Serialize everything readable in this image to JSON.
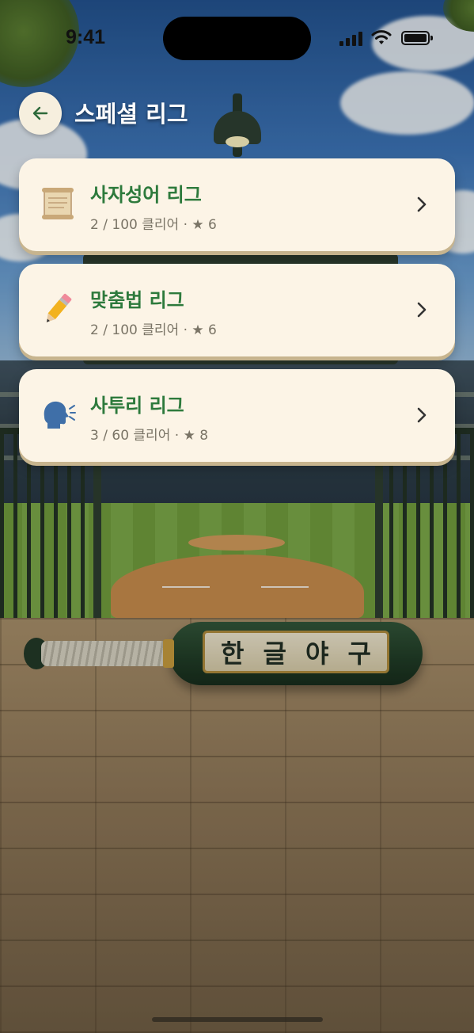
{
  "status_bar": {
    "time": "9:41"
  },
  "header": {
    "title": "스페셜 리그"
  },
  "leagues": [
    {
      "title": "사자성어 리그",
      "cleared": "2",
      "total": "100",
      "clear_label": "클리어",
      "separator": "·",
      "star": "★",
      "stars": "6",
      "icon": "scroll-icon"
    },
    {
      "title": "맞춤법 리그",
      "cleared": "2",
      "total": "100",
      "clear_label": "클리어",
      "separator": "·",
      "star": "★",
      "stars": "6",
      "icon": "pencil-icon"
    },
    {
      "title": "사투리 리그",
      "cleared": "3",
      "total": "60",
      "clear_label": "클리어",
      "separator": "·",
      "star": "★",
      "stars": "8",
      "icon": "speaking-head-icon"
    }
  ],
  "background": {
    "bat_text": [
      "한",
      "글",
      "야",
      "구"
    ]
  },
  "colors": {
    "card": "#fcf4e6",
    "title_green": "#2d7a3c",
    "meta_gray": "#7a7466"
  }
}
